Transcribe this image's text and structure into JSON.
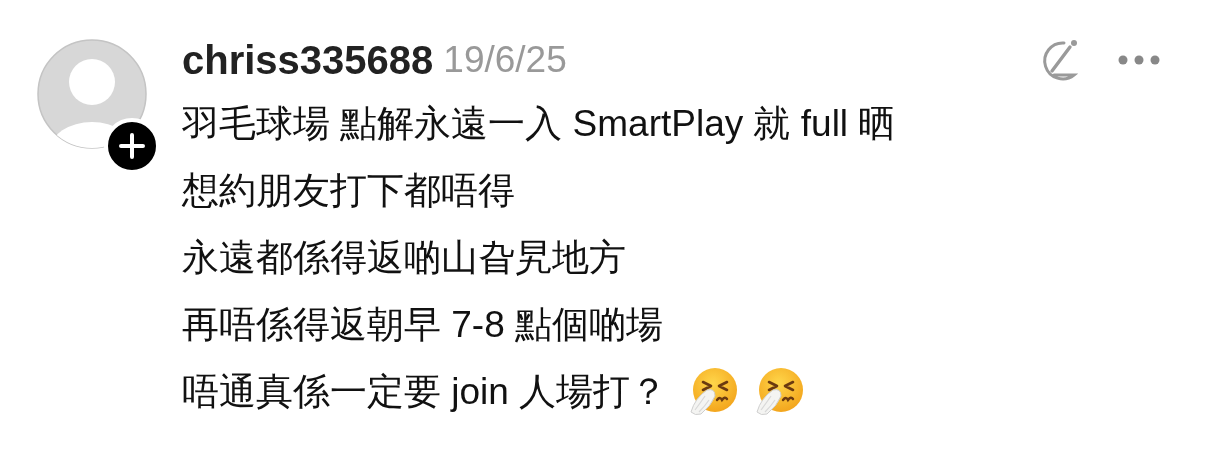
{
  "post": {
    "username": "chriss335688",
    "date": "19/6/25",
    "lines": [
      {
        "text": "羽毛球場 點解永遠一入 SmartPlay 就 full 晒"
      },
      {
        "text": "想約朋友打下都唔得"
      },
      {
        "text": "永遠都係得返啲山旮旯地方"
      },
      {
        "text": "再唔係得返朝早 7-8 點個啲場"
      },
      {
        "text": "唔通真係一定要 join 人場打？",
        "icons": [
          {
            "kind": "sneezing-face"
          },
          {
            "kind": "sneezing-face"
          }
        ]
      }
    ]
  }
}
